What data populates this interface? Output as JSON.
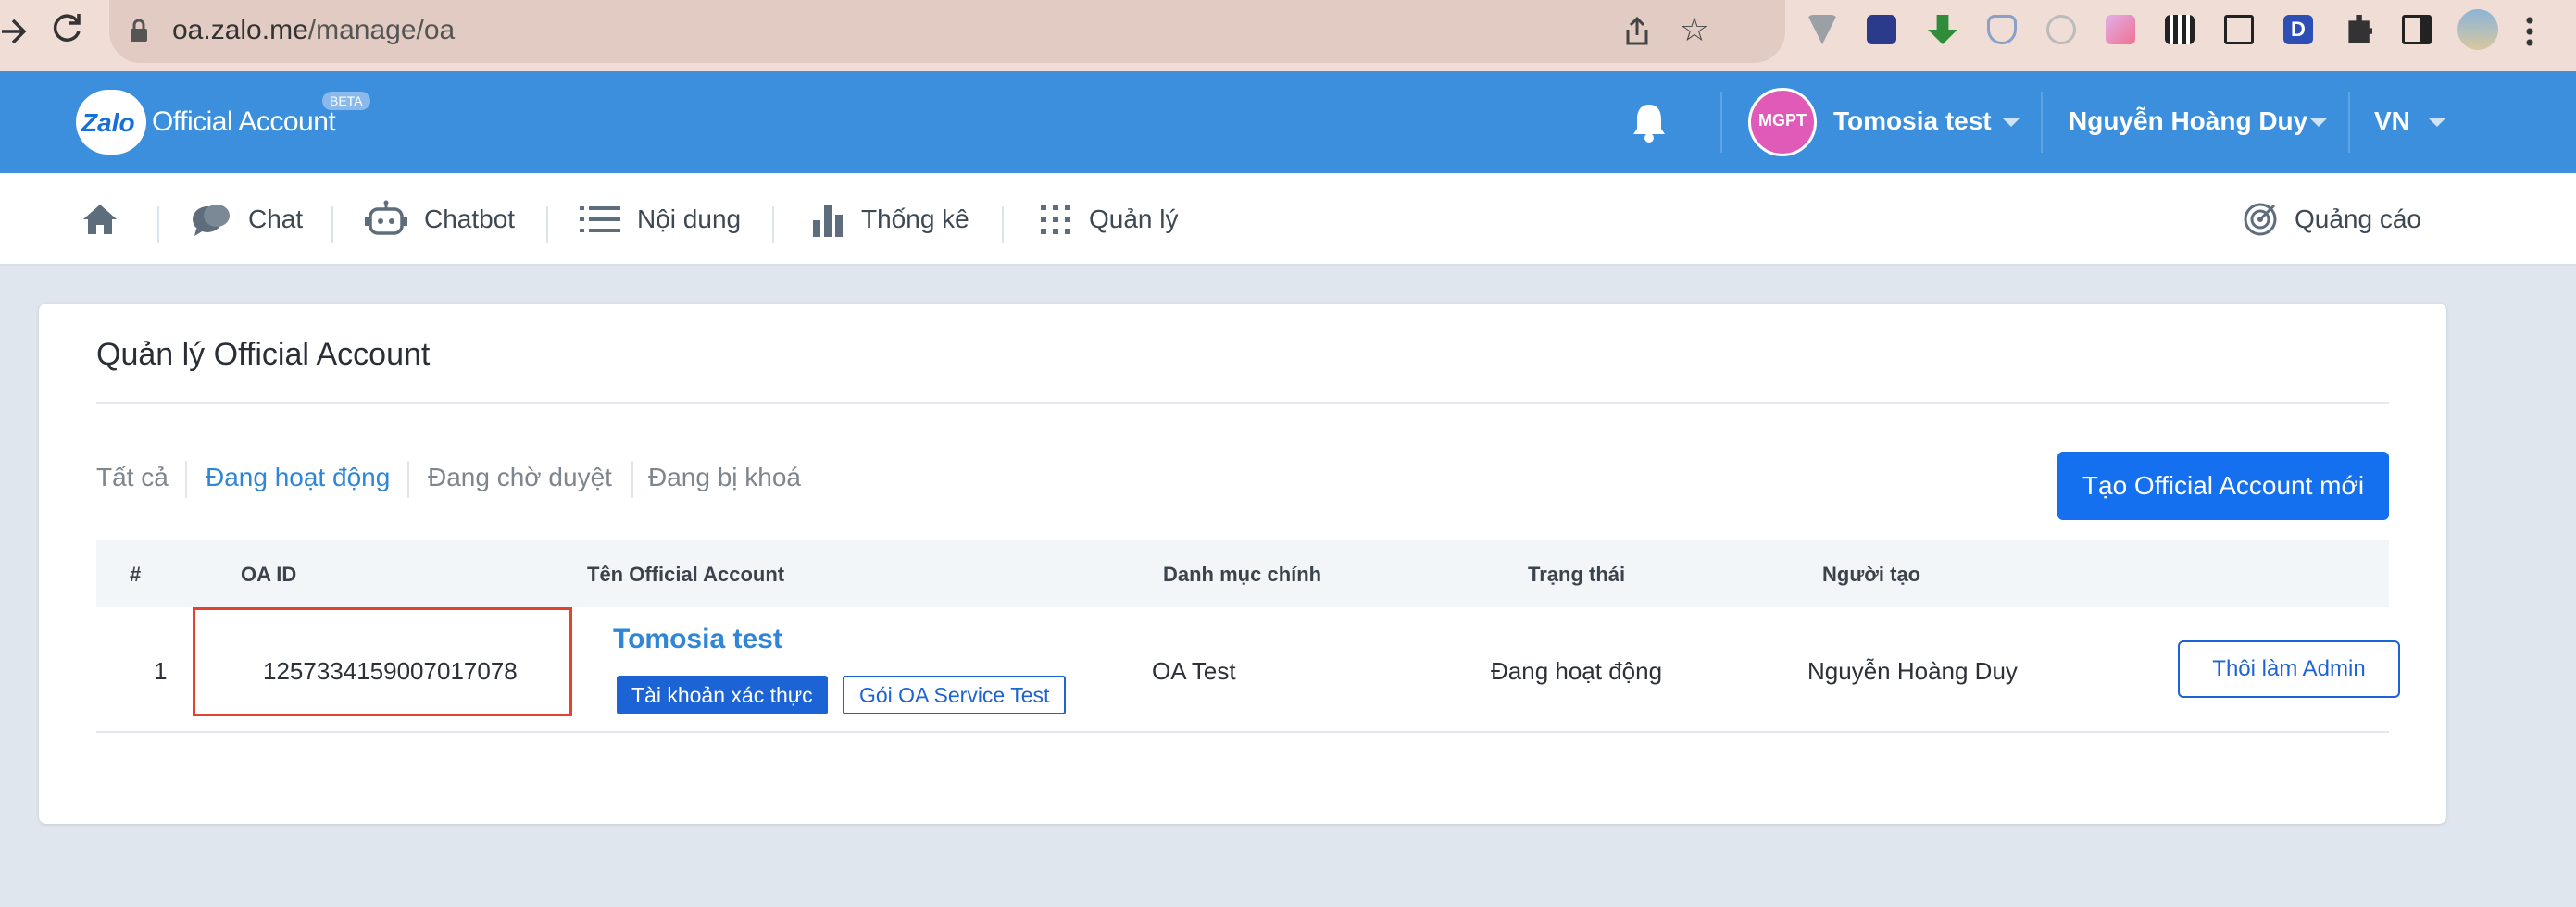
{
  "browser": {
    "url_host": "oa.zalo.me",
    "url_path": "/manage/oa"
  },
  "header": {
    "logo_text": "Zalo",
    "title": "Official Account",
    "beta": "BETA",
    "account_name": "Tomosia test",
    "avatar_text": "MGPT",
    "user_name": "Nguyễn Hoàng Duy",
    "language": "VN"
  },
  "nav": {
    "chat": "Chat",
    "chatbot": "Chatbot",
    "content": "Nội dung",
    "stats": "Thống kê",
    "manage": "Quản lý",
    "ads": "Quảng cáo"
  },
  "page": {
    "title": "Quản lý Official Account",
    "filters": [
      "Tất cả",
      "Đang hoạt động",
      "Đang chờ duyệt",
      "Đang bị khoá"
    ],
    "active_filter": "Đang hoạt động",
    "create_button": "Tạo Official Account mới"
  },
  "table": {
    "columns": [
      "#",
      "OA ID",
      "Tên Official Account",
      "Danh mục chính",
      "Trạng thái",
      "Người tạo"
    ],
    "rows": [
      {
        "index": "1",
        "oa_id": "1257334159007017078",
        "name": "Tomosia test",
        "badge_verified": "Tài khoản xác thực",
        "badge_package": "Gói OA Service Test",
        "category": "OA Test",
        "status": "Đang hoạt động",
        "creator": "Nguyễn Hoàng Duy",
        "action": "Thôi làm Admin"
      }
    ]
  },
  "colors": {
    "header_blue": "#3b8fdc",
    "primary": "#1570ef",
    "highlight_red": "#e2432f"
  }
}
